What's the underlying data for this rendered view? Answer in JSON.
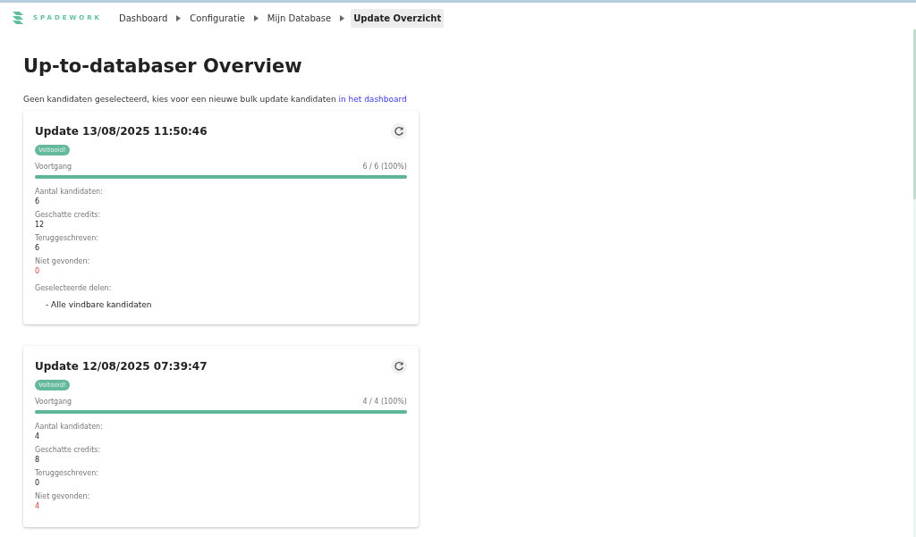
{
  "brand": "SPADEWORK",
  "breadcrumbs": [
    {
      "label": "Dashboard",
      "selected": false
    },
    {
      "label": "Configuratie",
      "selected": false
    },
    {
      "label": "Mijn Database",
      "selected": false
    },
    {
      "label": "Update Overzicht",
      "selected": true
    }
  ],
  "page": {
    "title": "Up-to-databaser Overview",
    "notice": "Geen kandidaten geselecteerd, kies voor een nieuwe bulk update kandidaten",
    "notice_link": "in het dashboard"
  },
  "updates": [
    {
      "title": "Update 13/08/2025 11:50:46",
      "status": "Voltooid!",
      "progress_label": "Voortgang",
      "progress_text": "6 / 6 (100%)",
      "level": 1,
      "fields": [
        {
          "label": "Aantal kandidaten:",
          "value": "6",
          "kind": "normal"
        },
        {
          "label": "Geschatte credits:",
          "value": "12",
          "kind": "normal"
        },
        {
          "label": "Teruggeschreven:",
          "value": "6",
          "kind": "normal"
        },
        {
          "label": "Niet gevonden:",
          "value": "0",
          "kind": "alert"
        }
      ],
      "sections_label": "Geselecteerde delen:",
      "sections": [
        "- Alle vindbare kandidaten"
      ]
    },
    {
      "title": "Update 12/08/2025 07:39:47",
      "status": "Voltooid!",
      "progress_label": "Voortgang",
      "progress_text": "4 / 4 (100%)",
      "level": 1,
      "fields": [
        {
          "label": "Aantal kandidaten:",
          "value": "4",
          "kind": "normal"
        },
        {
          "label": "Geschatte credits:",
          "value": "8",
          "kind": "normal"
        },
        {
          "label": "Teruggeschreven:",
          "value": "0",
          "kind": "normal"
        },
        {
          "label": "Niet gevonden:",
          "value": "4",
          "kind": "alert"
        }
      ]
    }
  ]
}
